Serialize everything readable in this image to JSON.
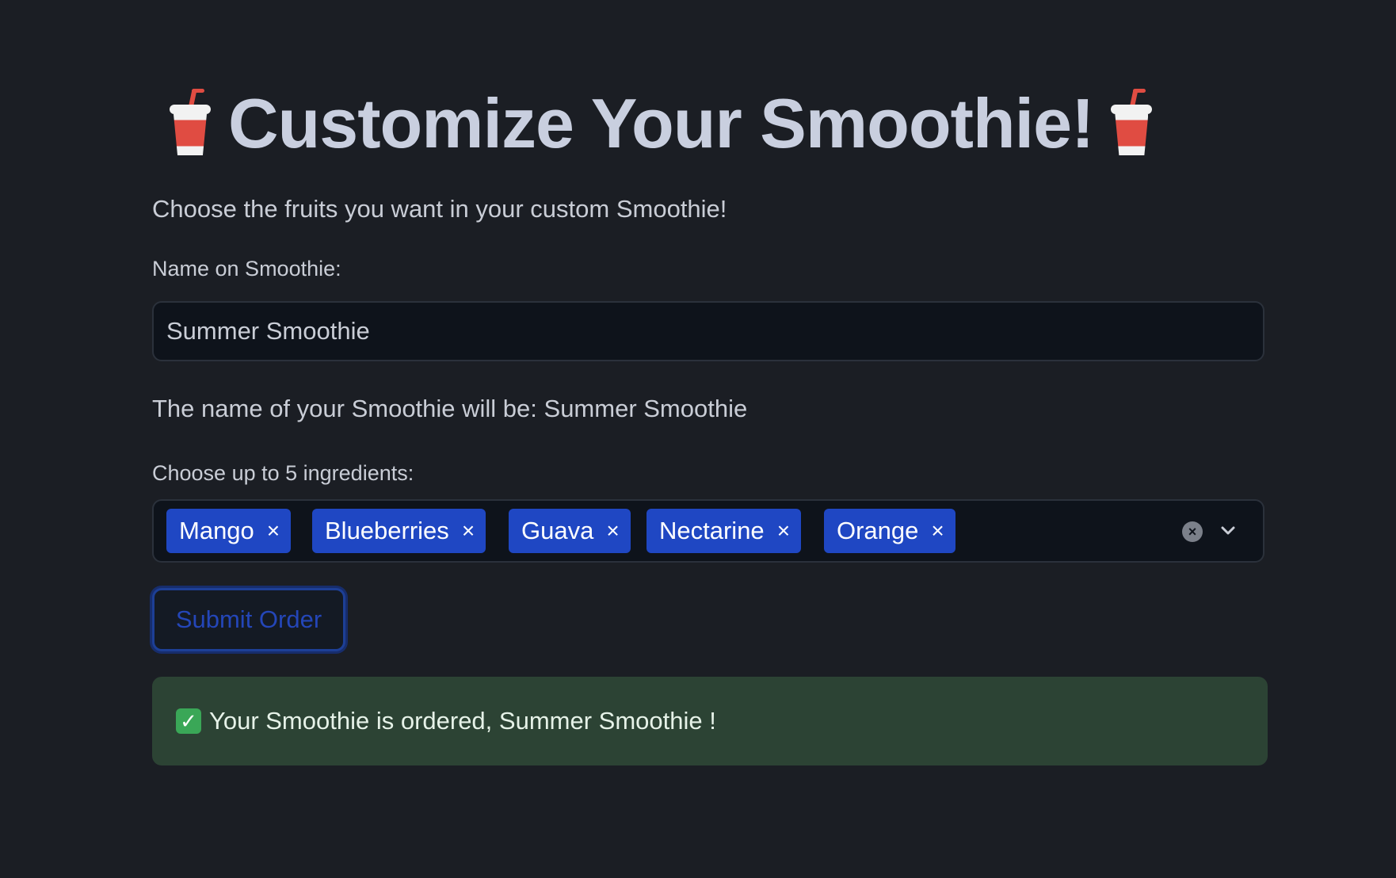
{
  "page": {
    "title": "Customize Your Smoothie!",
    "title_icon": "cup-with-straw-icon",
    "intro": "Choose the fruits you want in your custom Smoothie!"
  },
  "name_field": {
    "label": "Name on Smoothie:",
    "value": "Summer Smoothie"
  },
  "name_echo": "The name of your Smoothie will be: Summer Smoothie",
  "ingredients": {
    "label": "Choose up to 5 ingredients:",
    "selected": [
      "Mango",
      "Blueberries",
      "Guava",
      "Nectarine",
      "Orange"
    ],
    "remove_glyph": "×",
    "clear_icon": "clear-all-icon",
    "dropdown_icon": "chevron-down-icon"
  },
  "submit": {
    "label": "Submit Order"
  },
  "success": {
    "icon": "check-mark-icon",
    "message": "Your Smoothie is ordered, Summer Smoothie !"
  },
  "colors": {
    "background": "#1b1e24",
    "chip": "#1f47c3",
    "success_bg": "#2c4334",
    "accent": "#2446b8"
  }
}
